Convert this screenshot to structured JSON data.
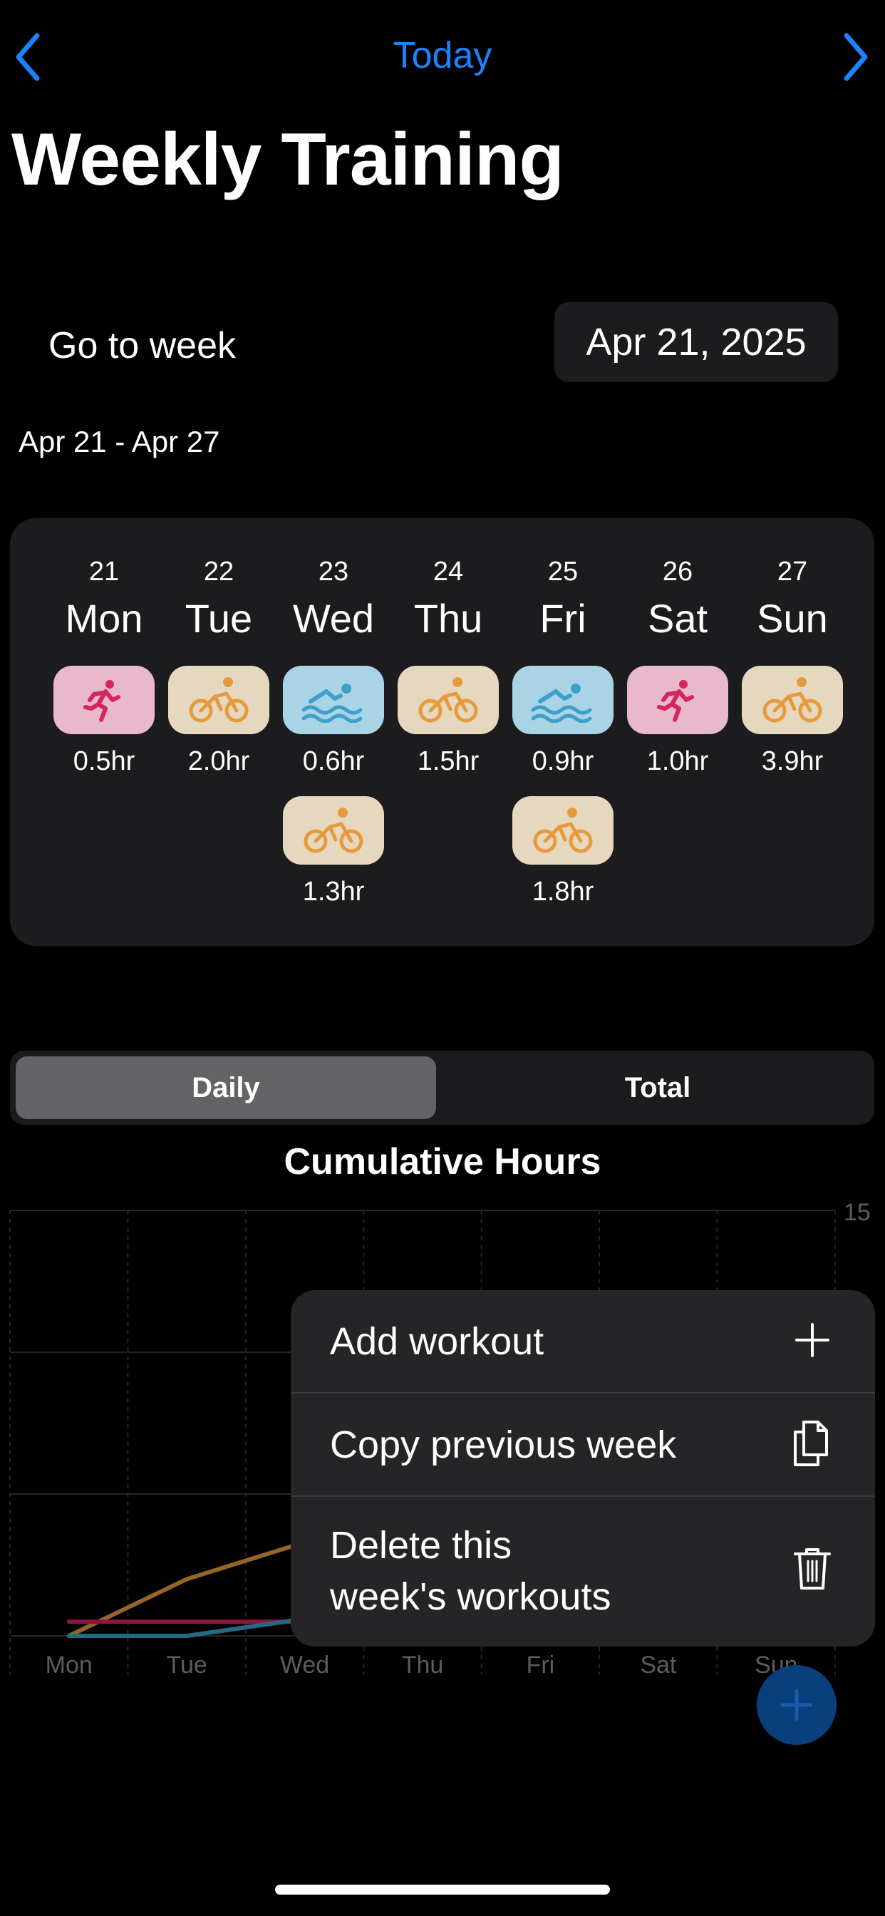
{
  "nav": {
    "title": "Today",
    "back_icon": "chevron-left-icon",
    "forward_icon": "chevron-right-icon",
    "accent": "#1a84ff"
  },
  "page": {
    "title": "Weekly Training"
  },
  "goto": {
    "label": "Go to week",
    "date": "Apr 21, 2025",
    "range": "Apr 21 - Apr 27"
  },
  "week": {
    "days": [
      {
        "num": "21",
        "name": "Mon",
        "workouts": [
          {
            "type": "run",
            "icon": "running-icon",
            "hours": "0.5hr"
          }
        ]
      },
      {
        "num": "22",
        "name": "Tue",
        "workouts": [
          {
            "type": "bike",
            "icon": "cycling-icon",
            "hours": "2.0hr"
          }
        ]
      },
      {
        "num": "23",
        "name": "Wed",
        "workouts": [
          {
            "type": "swim",
            "icon": "swimming-icon",
            "hours": "0.6hr"
          },
          {
            "type": "bike",
            "icon": "cycling-icon",
            "hours": "1.3hr"
          }
        ]
      },
      {
        "num": "24",
        "name": "Thu",
        "workouts": [
          {
            "type": "bike",
            "icon": "cycling-icon",
            "hours": "1.5hr"
          }
        ]
      },
      {
        "num": "25",
        "name": "Fri",
        "workouts": [
          {
            "type": "swim",
            "icon": "swimming-icon",
            "hours": "0.9hr"
          },
          {
            "type": "bike",
            "icon": "cycling-icon",
            "hours": "1.8hr"
          }
        ]
      },
      {
        "num": "26",
        "name": "Sat",
        "workouts": [
          {
            "type": "run",
            "icon": "running-icon",
            "hours": "1.0hr"
          }
        ]
      },
      {
        "num": "27",
        "name": "Sun",
        "workouts": [
          {
            "type": "bike",
            "icon": "cycling-icon",
            "hours": "3.9hr"
          }
        ]
      }
    ],
    "colors": {
      "run": "#d6245e",
      "bike": "#e69a3c",
      "swim": "#3da0c8"
    }
  },
  "segmented": {
    "options": [
      "Daily",
      "Total"
    ],
    "selected": "Daily"
  },
  "chart": {
    "title": "Cumulative Hours"
  },
  "chart_data": {
    "type": "line",
    "title": "Cumulative Hours",
    "categories": [
      "Mon",
      "Tue",
      "Wed",
      "Thu",
      "Fri",
      "Sat",
      "Sun"
    ],
    "ylim": [
      0,
      15
    ],
    "y_tick_labels": [
      "15"
    ],
    "grid": true,
    "series": [
      {
        "type": "bike",
        "color": "#e69a3c",
        "values": [
          0,
          2.0,
          3.3,
          4.8,
          6.6,
          6.6,
          10.5
        ]
      },
      {
        "type": "run",
        "color": "#d6245e",
        "values": [
          0.5,
          0.5,
          0.5,
          0.5,
          0.5,
          1.5,
          1.5
        ]
      },
      {
        "type": "swim",
        "color": "#3da0c8",
        "values": [
          0,
          0,
          0.6,
          0.6,
          1.5,
          1.5,
          1.5
        ]
      }
    ]
  },
  "menu": {
    "items": [
      {
        "label": "Add workout",
        "icon": "plus-icon"
      },
      {
        "label": "Copy previous week",
        "icon": "copy-icon"
      },
      {
        "label_line1": "Delete this",
        "label_line2": "week's workouts",
        "icon": "trash-icon"
      }
    ]
  },
  "fab": {
    "icon": "plus-icon",
    "color": "#0a3f7d"
  }
}
